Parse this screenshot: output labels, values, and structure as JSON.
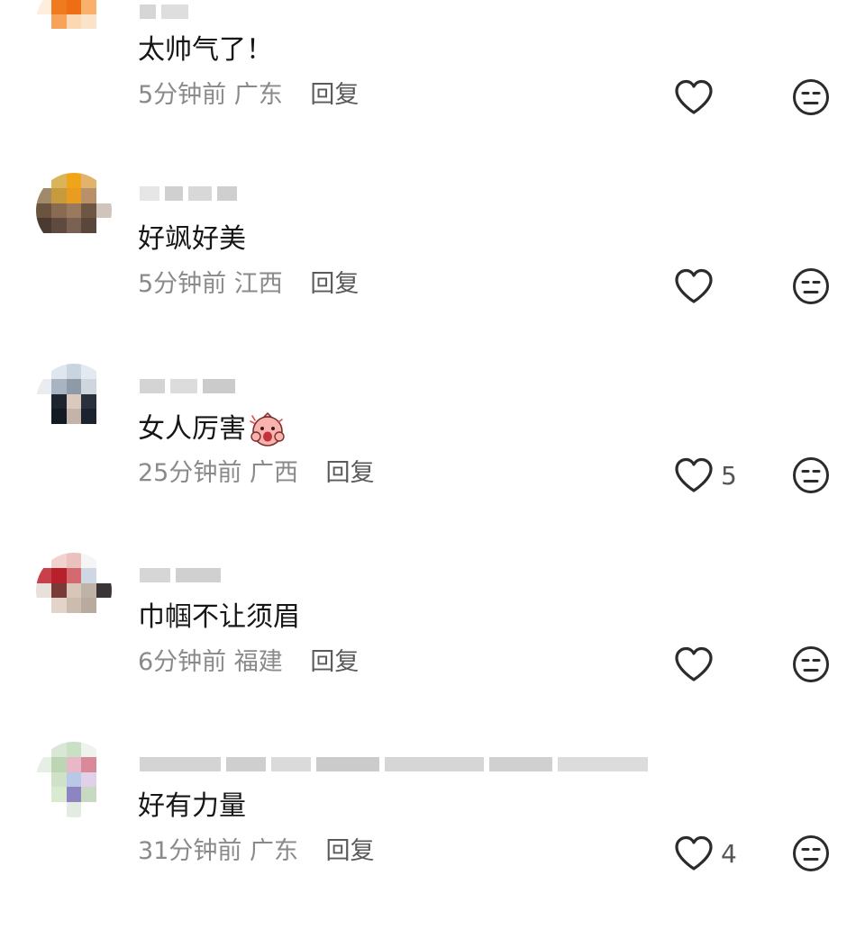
{
  "comments": [
    {
      "text": "太帅气了！",
      "time": "5分钟前",
      "region": "广东",
      "reply": "回复",
      "likes": ""
    },
    {
      "text": "好飒好美",
      "time": "5分钟前",
      "region": "江西",
      "reply": "回复",
      "likes": ""
    },
    {
      "text": "女人厉害",
      "time": "25分钟前",
      "region": "广西",
      "reply": "回复",
      "likes": "5"
    },
    {
      "text": "巾帼不让须眉",
      "time": "6分钟前",
      "region": "福建",
      "reply": "回复",
      "likes": ""
    },
    {
      "text": "好有力量",
      "time": "31分钟前",
      "region": "广东",
      "reply": "回复",
      "likes": "4"
    }
  ],
  "icons": {
    "like": "heart-outline-icon",
    "dislike": "meh-face-icon",
    "sticker": "surprised-pig-emoji"
  },
  "colors": {
    "text": "#161616",
    "meta": "#8a8a8a",
    "reply": "#5a5a5a",
    "icon": "#2b2b2b"
  }
}
